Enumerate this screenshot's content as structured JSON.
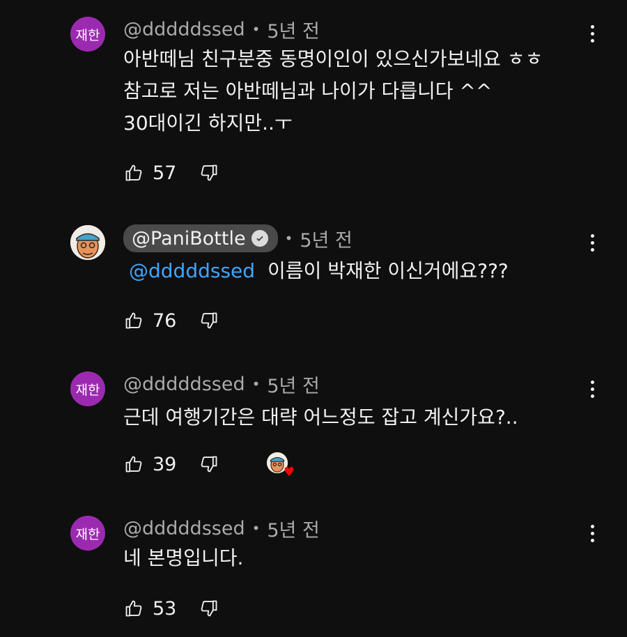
{
  "comments": [
    {
      "avatar_text": "재한",
      "author": "@dddddssed",
      "time": "5년 전",
      "lines": [
        "아반떼님 친구분중 동명이인이 있으신가보네요 ㅎㅎ",
        "참고로 저는 아반떼님과 나이가 다릅니다 ^^",
        "30대이긴 하지만..ㅜ"
      ],
      "likes": "57"
    },
    {
      "author": "@PaniBottle",
      "time": "5년 전",
      "mention": "@dddddssed",
      "text": "이름이 박재한 이신거에요???",
      "likes": "76"
    },
    {
      "avatar_text": "재한",
      "author": "@dddddssed",
      "time": "5년 전",
      "text": "근데 여행기간은 대략 어느정도 잡고 계신가요?..",
      "likes": "39"
    },
    {
      "avatar_text": "재한",
      "author": "@dddddssed",
      "time": "5년 전",
      "text": "네 본명입니다.",
      "likes": "53"
    }
  ],
  "separator": "•",
  "colors": {
    "background": "#0f0f0f",
    "avatar": "#9c2ab0",
    "mention": "#3ea6ff",
    "chip": "#4a4a4a",
    "heart": "#ff0000"
  }
}
